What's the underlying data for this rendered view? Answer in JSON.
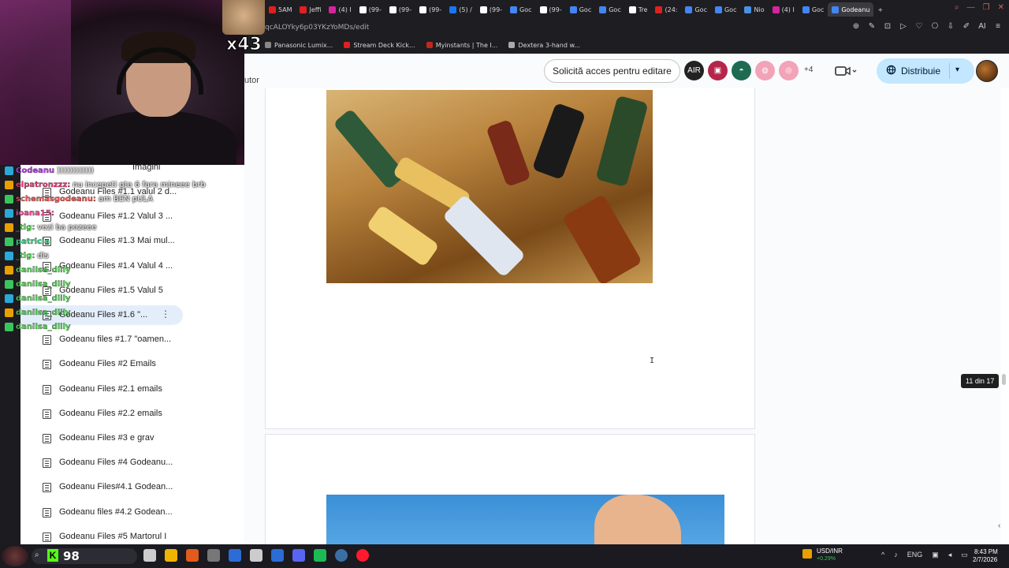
{
  "browser": {
    "tabs": [
      {
        "label": "5AM",
        "icon_color": "#e02020"
      },
      {
        "label": "Jeffi",
        "icon_color": "#e02020"
      },
      {
        "label": "(4) I",
        "icon_color": "#d6249f"
      },
      {
        "label": "(99-",
        "icon_color": "#ffffff"
      },
      {
        "label": "(99-",
        "icon_color": "#ffffff"
      },
      {
        "label": "(99-",
        "icon_color": "#ffffff"
      },
      {
        "label": "(5) /",
        "icon_color": "#1877f2"
      },
      {
        "label": "(99-",
        "icon_color": "#ffffff"
      },
      {
        "label": "Goc",
        "icon_color": "#4285f4"
      },
      {
        "label": "(99-",
        "icon_color": "#ffffff"
      },
      {
        "label": "Goc",
        "icon_color": "#4285f4"
      },
      {
        "label": "Goc",
        "icon_color": "#4285f4"
      },
      {
        "label": "Tre",
        "icon_color": "#ffffff"
      },
      {
        "label": "(24:",
        "icon_color": "#e02020"
      },
      {
        "label": "Goc",
        "icon_color": "#4285f4"
      },
      {
        "label": "Goc",
        "icon_color": "#4285f4"
      },
      {
        "label": "Nio",
        "icon_color": "#4a90e2"
      },
      {
        "label": "(4) I",
        "icon_color": "#d6249f"
      },
      {
        "label": "Goc",
        "icon_color": "#4285f4"
      },
      {
        "label": "Godeanu",
        "icon_color": "#4285f4"
      }
    ],
    "new_tab": "+",
    "url_partial": "qcALOYky6p03YKzYoMDs/edit",
    "bookmarks": [
      {
        "label": "Panasonic Lumix...",
        "icon_color": "#888888"
      },
      {
        "label": "Stream Deck Kick...",
        "icon_color": "#e02020"
      },
      {
        "label": "Myinstants | The I...",
        "icon_color": "#c0281c"
      },
      {
        "label": "Dextera 3-hand w...",
        "icon_color": "#aaaaaa"
      }
    ],
    "url_actions": [
      "⊕",
      "✎",
      "⊡",
      "▷",
      "♡",
      "⎔",
      "⇩",
      "✐",
      "AI",
      "≡"
    ]
  },
  "docs_toolbar": {
    "partial_label": "utor",
    "request_edit": "Solicită acces pentru editare",
    "avatars": [
      {
        "text": "AIR",
        "color": "#222222"
      },
      {
        "text": "▣",
        "color": "#b5254a"
      },
      {
        "text": "◓",
        "color": "#1e6b52"
      },
      {
        "text": "◍",
        "color": "#f2a3b7"
      },
      {
        "text": "◎",
        "color": "#f2a3b7"
      }
    ],
    "more_users": "+4",
    "meet": "▭▸",
    "share_label": "Distribuie",
    "share_icon": "globe-icon"
  },
  "webcam": {
    "cat_count": "x43"
  },
  "outline": {
    "header_partial": "Imagini",
    "items": [
      {
        "label": "Godeanu Files #1.1 valul 2 d...",
        "top": 0
      },
      {
        "label": "Godeanu Files #1.2 Valul 3 ...",
        "top": 0
      },
      {
        "label": "Godeanu Files #1.3 Mai mul...",
        "top": 0
      },
      {
        "label": "Godeanu Files #1.4 Valul 4 ...",
        "top": 0
      },
      {
        "label": "Godeanu Files #1.5 Valul 5",
        "top": 0
      },
      {
        "label": "Godeanu Files #1.6 \"...",
        "top": 0,
        "selected": true
      },
      {
        "label": "Godeanu files #1.7 \"oamen...",
        "top": 0
      },
      {
        "label": "Godeanu Files #2 Emails",
        "top": 0
      },
      {
        "label": "Godeanu Files #2.1 emails",
        "top": 0
      },
      {
        "label": "Godeanu Files #2.2 emails",
        "top": 0
      },
      {
        "label": "Godeanu Files #3 e grav",
        "top": 0
      },
      {
        "label": "Godeanu Files #4 Godeanu...",
        "top": 0
      },
      {
        "label": "Godeanu Files#4.1 Godean...",
        "top": 0
      },
      {
        "label": "Godeanu files #4.2 Godean...",
        "top": 0
      },
      {
        "label": "Godeanu Files #5 Martorul I",
        "top": 0
      }
    ]
  },
  "chat": [
    {
      "user": "Codeanu",
      "msg": "))))))))))))",
      "user_color": "#c83cff"
    },
    {
      "user": "elpatronzzz:",
      "msg": "nu incepeti gta 6 fara mineee brb",
      "user_color": "#ff3c7a"
    },
    {
      "user": "schemasgodeanu:",
      "msg": "am BEN pULA",
      "user_color": "#ff5a5a"
    },
    {
      "user": "ioana15:",
      "msg": "",
      "user_color": "#ff4a9a"
    },
    {
      "user": "_tig:",
      "msg": "vezi ba pozeee",
      "user_color": "#5ce05c"
    },
    {
      "user": "patricia",
      "msg": "",
      "user_color": "#3cdc8c"
    },
    {
      "user": "_tig:",
      "msg": "dis",
      "user_color": "#5ce05c"
    },
    {
      "user": "danilsa_dilly",
      "msg": "",
      "user_color": "#5ce05c"
    },
    {
      "user": "danilsa_dilly",
      "msg": "",
      "user_color": "#5ce05c"
    },
    {
      "user": "danilsa_dilly",
      "msg": "",
      "user_color": "#5ce05c"
    },
    {
      "user": "danilsa_dilly",
      "msg": "",
      "user_color": "#5ce05c"
    },
    {
      "user": "danilsa_dilly",
      "msg": "",
      "user_color": "#5ce05c"
    }
  ],
  "doc": {
    "page_indicator": "11 din 17",
    "cursor": "I"
  },
  "taskbar": {
    "kick_logo": "K",
    "kick_count": "98",
    "apps": [
      "#cccccc",
      "#f0b400",
      "#e25a1c",
      "#777777",
      "#2b6cd6",
      "#cccccc",
      "#2b6cd6",
      "#5865f2",
      "#1db954",
      "#3b6ea5",
      "#ff1b2d"
    ],
    "fx_pair": "USD/INR",
    "fx_change": "+0.29%",
    "lang": "ENG",
    "time": "8:43 PM",
    "date": "2/7/2026"
  }
}
